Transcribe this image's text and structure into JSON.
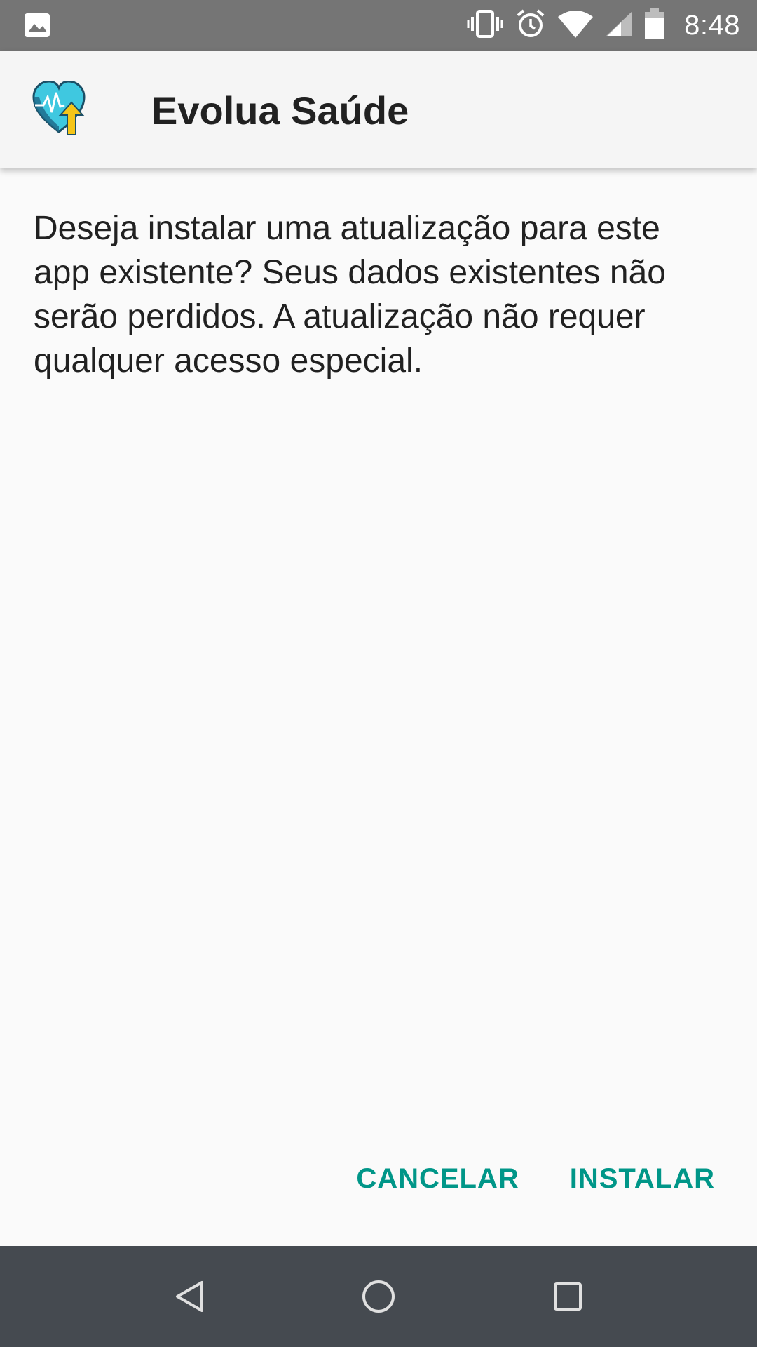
{
  "status_bar": {
    "time": "8:48",
    "icons": [
      "image-icon",
      "vibrate-icon",
      "alarm-icon",
      "wifi-icon",
      "signal-icon",
      "battery-icon"
    ]
  },
  "header": {
    "app_name": "Evolua Saúde",
    "logo_icon": "heart-pulse-arrow-icon"
  },
  "dialog": {
    "message": "Deseja instalar uma atualização para este app existente? Seus dados existentes não serão perdidos. A atualização não requer qualquer acesso especial.",
    "buttons": {
      "cancel": "CANCELAR",
      "install": "INSTALAR"
    }
  },
  "nav_bar": {
    "icons": [
      "back-icon",
      "home-icon",
      "recents-icon"
    ]
  },
  "colors": {
    "status_bar": "#757575",
    "header_bg": "#f5f5f5",
    "accent": "#009688",
    "nav_bar": "#454a50"
  }
}
